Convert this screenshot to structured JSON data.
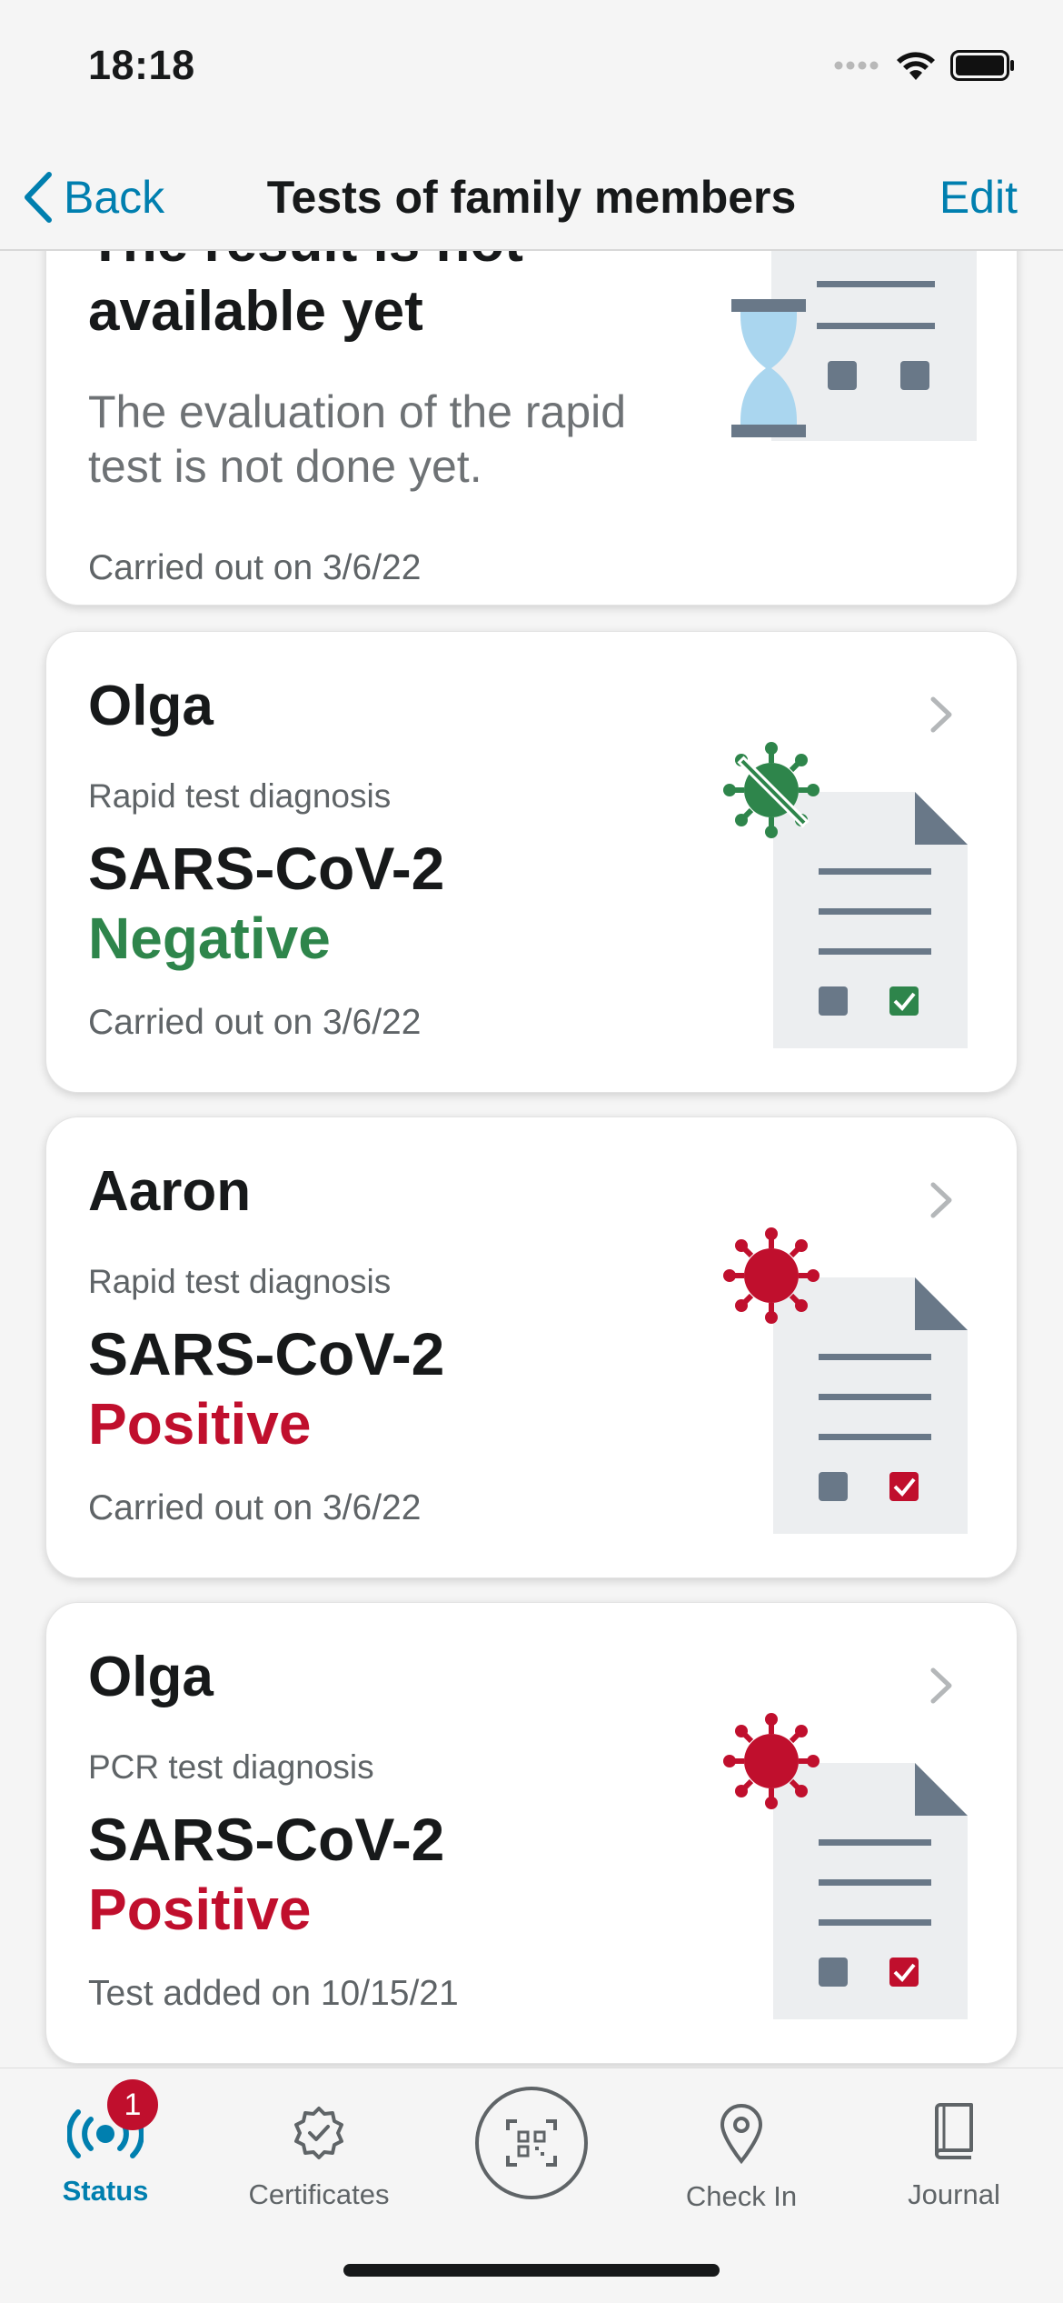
{
  "status_bar": {
    "time": "18:18"
  },
  "nav": {
    "back_label": "Back",
    "title": "Tests of family members",
    "edit_label": "Edit"
  },
  "pending_card": {
    "title_line1": "The result is not",
    "title_line2": "available yet",
    "description_line1": "The evaluation of the rapid",
    "description_line2": "test is not done yet.",
    "date": "Carried out on 3/6/22"
  },
  "cards": [
    {
      "name": "Olga",
      "test_type": "Rapid test diagnosis",
      "virus": "SARS-CoV-2",
      "result": "Negative",
      "date": "Carried out on 3/6/22",
      "result_color": "#2e854b"
    },
    {
      "name": "Aaron",
      "test_type": "Rapid test diagnosis",
      "virus": "SARS-CoV-2",
      "result": "Positive",
      "date": "Carried out on 3/6/22",
      "result_color": "#c00f2d"
    },
    {
      "name": "Olga",
      "test_type": "PCR test diagnosis",
      "virus": "SARS-CoV-2",
      "result": "Positive",
      "date": "Test added on 10/15/21",
      "result_color": "#c00f2d"
    }
  ],
  "tabs": [
    {
      "label": "Status",
      "icon": "status-icon",
      "badge": "1",
      "active": true
    },
    {
      "label": "Certificates",
      "icon": "certificate-icon"
    },
    {
      "label": "",
      "icon": "qr-scan-icon"
    },
    {
      "label": "Check In",
      "icon": "location-pin-icon"
    },
    {
      "label": "Journal",
      "icon": "journal-icon"
    }
  ],
  "colors": {
    "accent": "#007faf",
    "negative": "#2e854b",
    "positive": "#c00f2d"
  }
}
